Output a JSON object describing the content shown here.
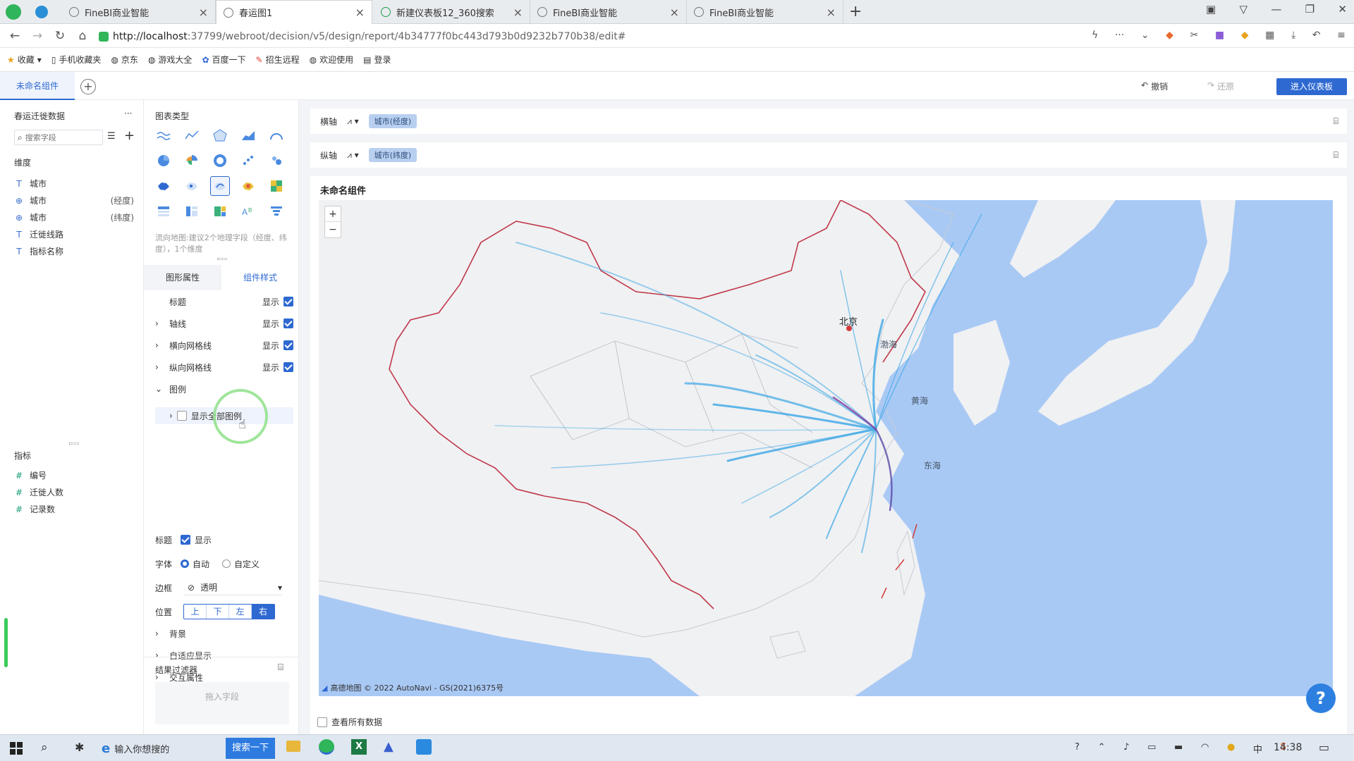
{
  "browser": {
    "tabs": [
      {
        "label": "FineBI商业智能",
        "active": false
      },
      {
        "label": "春运图1",
        "active": true
      },
      {
        "label": "新建仪表板12_360搜索",
        "active": false
      },
      {
        "label": "FineBI商业智能",
        "active": false
      },
      {
        "label": "FineBI商业智能",
        "active": false
      }
    ],
    "url_host": "http://localhost",
    "url_rest": ":37799/webroot/decision/v5/design/report/4b34777f0bc443d793b0d9232b770b38/edit#",
    "bookmarks": [
      "收藏",
      "手机收藏夹",
      "京东",
      "游戏大全",
      "百度一下",
      "招生远程",
      "欢迎使用",
      "登录"
    ]
  },
  "app": {
    "component_tab": "未命名组件",
    "undo": "撤销",
    "redo": "还原",
    "enter_dashboard": "进入仪表板"
  },
  "left": {
    "dataset": "春运迁徙数据",
    "more": "···",
    "search_placeholder": "搜索字段",
    "dimension_title": "维度",
    "dimensions": [
      {
        "icon": "T",
        "name": "城市",
        "suffix": ""
      },
      {
        "icon": "⊕",
        "name": "城市",
        "suffix": "(经度)"
      },
      {
        "icon": "⊕",
        "name": "城市",
        "suffix": "(纬度)"
      },
      {
        "icon": "T",
        "name": "迁徙线路",
        "suffix": ""
      },
      {
        "icon": "T",
        "name": "指标名称",
        "suffix": ""
      }
    ],
    "measure_title": "指标",
    "measures": [
      {
        "icon": "#",
        "name": "编号"
      },
      {
        "icon": "#",
        "name": "迁徙人数"
      },
      {
        "icon": "#",
        "name": "记录数"
      }
    ]
  },
  "mid": {
    "chart_type_title": "图表类型",
    "chart_hint": "流向地图:建议2个地理字段（经度、纬度），1个维度",
    "tab_shape": "图形属性",
    "tab_style": "组件样式",
    "title_row": "标题",
    "show": "显示",
    "axis": "轴线",
    "hgrid": "横向网格线",
    "vgrid": "纵向网格线",
    "legend": "图例",
    "show_all_legend": "显示全部图例",
    "legend_title": "标题",
    "font": "字体",
    "font_auto": "自动",
    "font_custom": "自定义",
    "border": "边框",
    "border_value": "透明",
    "position": "位置",
    "positions": [
      "上",
      "下",
      "左",
      "右"
    ],
    "background": "背景",
    "adaptive": "自适应显示",
    "interaction": "交互属性",
    "result_filter": "结果过滤器",
    "drop_field": "拖入字段"
  },
  "main": {
    "x_axis_label": "横轴",
    "x_axis_field": "城市(经度)",
    "y_axis_label": "纵轴",
    "y_axis_field": "城市(纬度)",
    "chart_title": "未命名组件",
    "map_labels": {
      "beijing": "北京",
      "bohai": "渤海",
      "huanghai": "黄海",
      "donghai": "东海"
    },
    "zoom_in": "+",
    "zoom_out": "−",
    "attribution": "高德地图 © 2022 AutoNavi - GS(2021)6375号",
    "view_all_data": "查看所有数据",
    "help": "?"
  },
  "taskbar": {
    "search_text": "输入你想搜的",
    "search_button": "搜索一下",
    "time": "14:38",
    "tray_char": "中"
  },
  "colors": {
    "accent": "#2e69d1",
    "flow_line": "#3aa6e6",
    "sea": "#a9c9f5",
    "land": "#f0f1f3",
    "border_red": "#c0394a"
  }
}
